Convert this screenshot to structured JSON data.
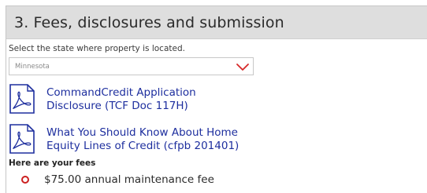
{
  "section": {
    "title": "3. Fees, disclosures and submission"
  },
  "state_selector": {
    "label": "Select the state where property is located.",
    "selected_value": "Minnesota",
    "chevron_icon": "chevron-down-icon",
    "chevron_color": "#d62828"
  },
  "documents": [
    {
      "icon": "pdf-icon",
      "line1": "CommandCredit  Application",
      "line2": "Disclosure (TCF Doc 117H)"
    },
    {
      "icon": "pdf-icon",
      "line1": "What You Should Know About Home",
      "line2": "Equity Lines of Credit (cfpb 201401)"
    }
  ],
  "fees": {
    "heading": "Here are your fees",
    "items": [
      {
        "text": "$75.00 annual maintenance fee"
      }
    ]
  },
  "colors": {
    "link": "#1d2e9e",
    "accent": "#cc1f1f",
    "header_bg": "#dedede"
  }
}
